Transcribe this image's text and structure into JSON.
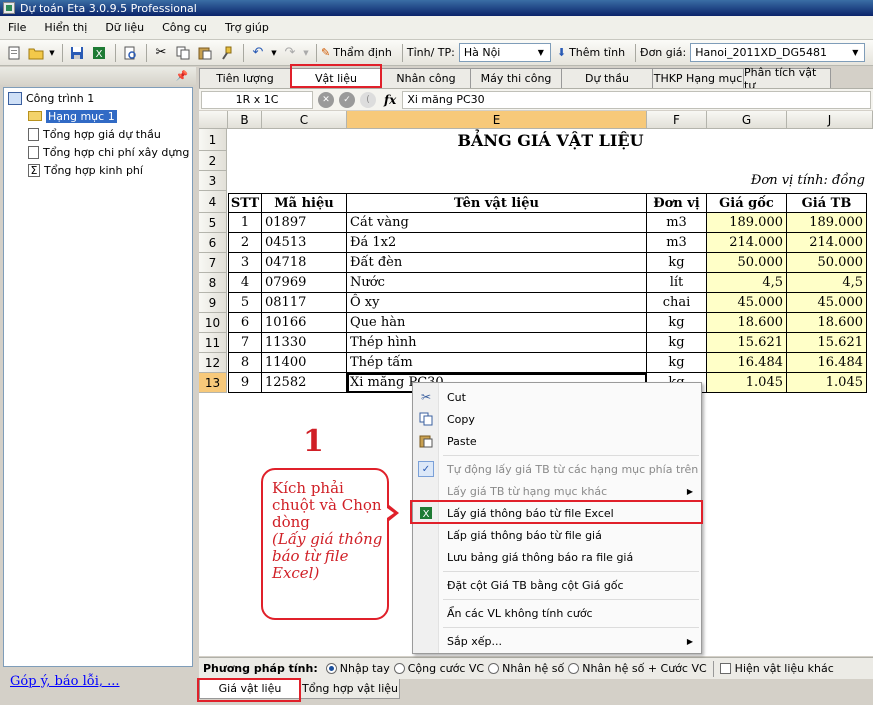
{
  "window": {
    "title": "Dự toán Eta 3.0.9.5 Professional"
  },
  "menu": [
    "File",
    "Hiển thị",
    "Dữ liệu",
    "Công cụ",
    "Trợ giúp"
  ],
  "toolbar": {
    "review_label": "Thẩm định",
    "province_label": "Tỉnh/ TP:",
    "province_value": "Hà Nội",
    "add_province_label": "Thêm tỉnh",
    "price_label": "Đơn giá:",
    "price_value": "Hanoi_2011XD_DG5481"
  },
  "tree": {
    "root": "Công trình 1",
    "items": [
      "Hạng mục 1",
      "Tổng hợp giá dự thầu",
      "Tổng hợp chi phí xây dựng",
      "Tổng hợp kinh phí"
    ]
  },
  "feedback_link": "Góp ý, báo lỗi, ...",
  "top_tabs": [
    "Tiên lượng",
    "Vật liệu",
    "Nhân công",
    "Máy thi công",
    "Dự thầu",
    "THKP Hạng mục",
    "Phân tích vật tư"
  ],
  "formula_bar": {
    "cell_ref": "1R x 1C",
    "fx": "fx",
    "value": "Xi măng PC30"
  },
  "sheet": {
    "columns": [
      "B",
      "C",
      "E",
      "F",
      "G",
      "J"
    ],
    "row_numbers": [
      "1",
      "2",
      "3",
      "4",
      "5",
      "6",
      "7",
      "8",
      "9",
      "10",
      "11",
      "12",
      "13"
    ],
    "title": "BẢNG GIÁ VẬT LIỆU",
    "unit_note": "Đơn vị tính: đồng",
    "headers": [
      "STT",
      "Mã hiệu",
      "Tên vật liệu",
      "Đơn vị",
      "Giá gốc",
      "Giá TB"
    ],
    "rows": [
      [
        "1",
        "01897",
        "Cát vàng",
        "m3",
        "189.000",
        "189.000"
      ],
      [
        "2",
        "04513",
        "Đá 1x2",
        "m3",
        "214.000",
        "214.000"
      ],
      [
        "3",
        "04718",
        "Đất đèn",
        "kg",
        "50.000",
        "50.000"
      ],
      [
        "4",
        "07969",
        "Nước",
        "lít",
        "4,5",
        "4,5"
      ],
      [
        "5",
        "08117",
        "Ô xy",
        "chai",
        "45.000",
        "45.000"
      ],
      [
        "6",
        "10166",
        "Que hàn",
        "kg",
        "18.600",
        "18.600"
      ],
      [
        "7",
        "11330",
        "Thép hình",
        "kg",
        "15.621",
        "15.621"
      ],
      [
        "8",
        "11400",
        "Thép tấm",
        "kg",
        "16.484",
        "16.484"
      ],
      [
        "9",
        "12582",
        "Xi măng PC30",
        "kg",
        "1.045",
        "1.045"
      ]
    ]
  },
  "context_menu": {
    "cut": "Cut",
    "copy": "Copy",
    "paste": "Paste",
    "auto_price": "Tự động lấy giá TB từ các hạng mục phía trên",
    "price_from_other": "Lấy giá TB từ hạng mục khác",
    "price_from_excel": "Lấy giá thông báo từ file Excel",
    "price_from_file": "Lấp giá thông báo từ file giá",
    "save_price": "Lưu bảng giá thông báo ra file giá",
    "set_col": "Đặt cột Giá TB bằng cột Giá gốc",
    "hide_vl": "Ẩn các VL không tính cước",
    "sort": "Sắp xếp..."
  },
  "annotation": {
    "number": "1",
    "line1": "Kích phải chuột và Chọn dòng",
    "line2": "(Lấy giá thông báo từ file Excel)"
  },
  "method_bar": {
    "label": "Phương pháp tính:",
    "options": [
      "Nhập tay",
      "Cộng cước VC",
      "Nhân hệ số",
      "Nhân hệ số + Cước VC"
    ],
    "show_other": "Hiện vật liệu khác"
  },
  "bottom_tabs": [
    "Giá vật liệu",
    "Tổng hợp vật liệu"
  ],
  "colors": {
    "highlight_red": "#e0202a",
    "selected_header": "#f7c97a",
    "price_yellow": "#ffffc8"
  }
}
